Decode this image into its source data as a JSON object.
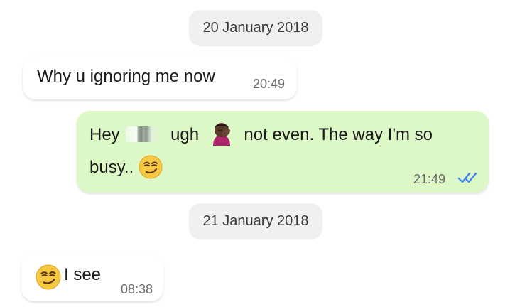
{
  "dates": [
    "20 January 2018",
    "21 January 2018"
  ],
  "messages": [
    {
      "direction": "incoming",
      "text": "Why u ignoring me now",
      "time": "20:49"
    },
    {
      "direction": "outgoing",
      "line1_part1": "Hey",
      "line1_part2": "ugh",
      "line1_part3": "not even. The way I'm so",
      "line2_part1": "busy..",
      "time": "21:49",
      "status_icon": "double-check-icon",
      "status_color": "#3b82f6"
    },
    {
      "direction": "incoming",
      "leading_emoji": "smirking-face-emoji",
      "text": "I see",
      "time": "08:38"
    }
  ],
  "colors": {
    "outgoing_bubble": "#dcf8c6",
    "incoming_bubble": "#ffffff",
    "date_chip": "#f0f0f0",
    "timestamp": "#6a6a6a",
    "read_receipt": "#3b82f6"
  }
}
